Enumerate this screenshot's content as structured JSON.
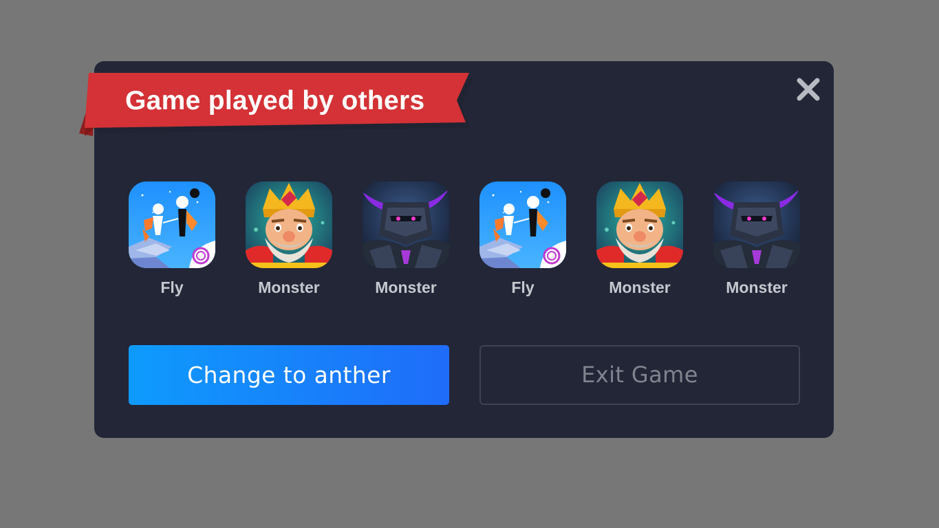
{
  "dialog": {
    "title": "Game played by others",
    "close_icon": "close-icon",
    "games": [
      {
        "name": "Fly",
        "icon": "fly-game-icon"
      },
      {
        "name": "Monster",
        "icon": "king-monster-game-icon"
      },
      {
        "name": "Monster",
        "icon": "dark-knight-monster-game-icon"
      },
      {
        "name": "Fly",
        "icon": "fly-game-icon"
      },
      {
        "name": "Monster",
        "icon": "king-monster-game-icon"
      },
      {
        "name": "Monster",
        "icon": "dark-knight-monster-game-icon"
      }
    ],
    "primary_button": "Change to anther",
    "secondary_button": "Exit Game"
  },
  "colors": {
    "overlay": "#777777",
    "dialog_background": "#222637",
    "ribbon_red": "#d43236",
    "primary_gradient_start": "#0e9bfd",
    "primary_gradient_end": "#1f6cf9",
    "secondary_text": "#80848f"
  }
}
